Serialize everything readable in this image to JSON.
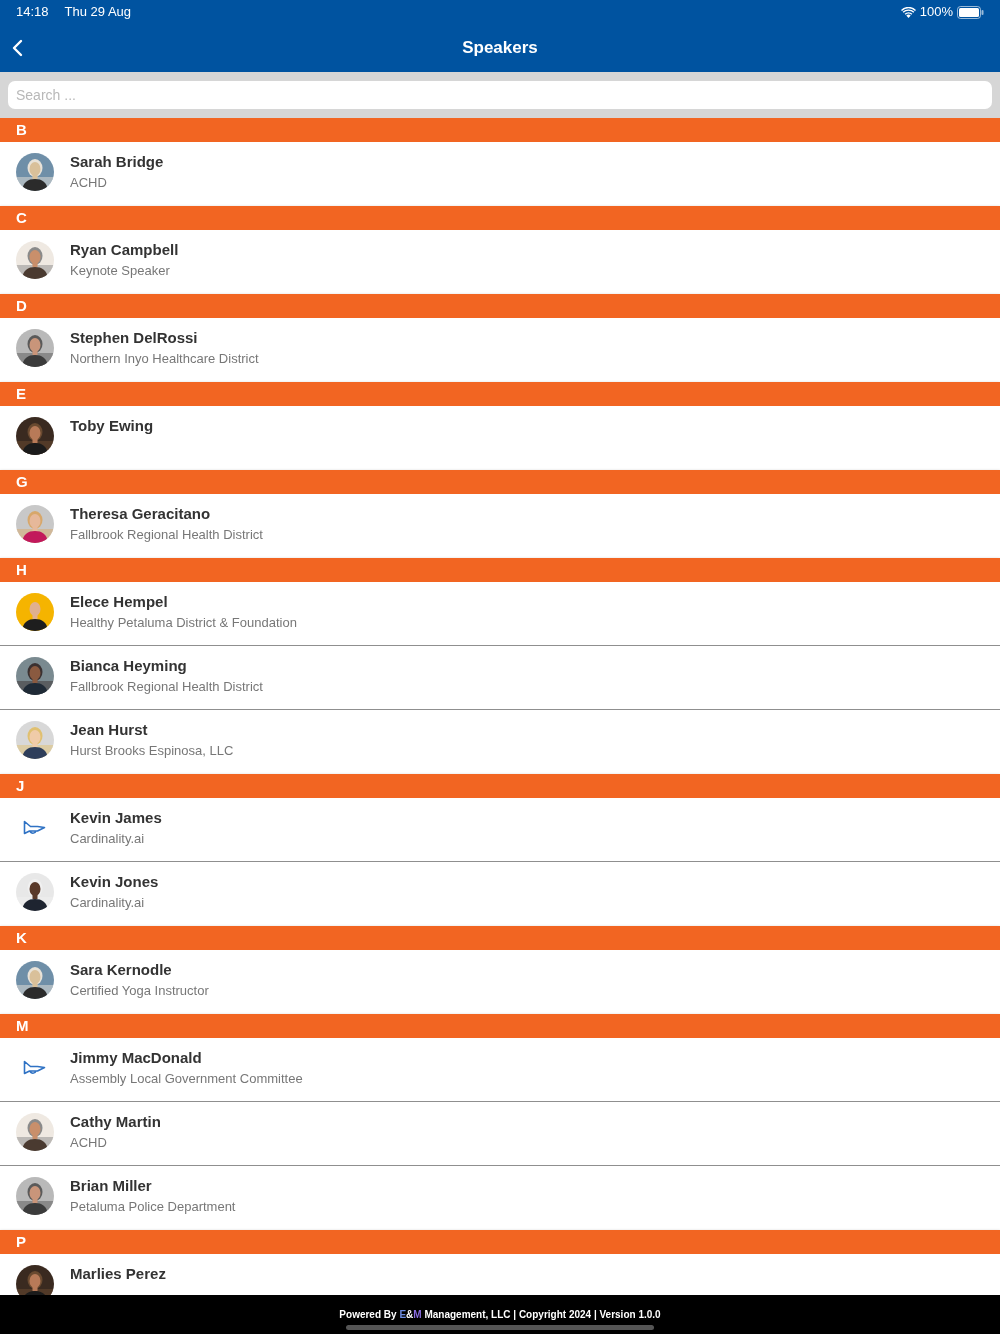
{
  "status_bar": {
    "time": "14:18",
    "date": "Thu 29 Aug",
    "battery": "100%"
  },
  "nav": {
    "title": "Speakers"
  },
  "search": {
    "placeholder": "Search ..."
  },
  "sections": [
    {
      "letter": "B",
      "speakers": [
        {
          "name": "Sarah Bridge",
          "org": "ACHD"
        }
      ]
    },
    {
      "letter": "C",
      "speakers": [
        {
          "name": "Ryan Campbell",
          "org": "Keynote Speaker"
        }
      ]
    },
    {
      "letter": "D",
      "speakers": [
        {
          "name": "Stephen DelRossi",
          "org": "Northern Inyo Healthcare District"
        }
      ]
    },
    {
      "letter": "E",
      "speakers": [
        {
          "name": "Toby Ewing"
        }
      ]
    },
    {
      "letter": "G",
      "speakers": [
        {
          "name": "Theresa Geracitano",
          "org": "Fallbrook Regional Health District"
        }
      ]
    },
    {
      "letter": "H",
      "speakers": [
        {
          "name": "Elece Hempel",
          "org": "Healthy Petaluma District & Foundation"
        },
        {
          "name": "Bianca Heyming",
          "org": "Fallbrook Regional Health District"
        },
        {
          "name": "Jean Hurst",
          "org": "Hurst Brooks Espinosa, LLC"
        }
      ]
    },
    {
      "letter": "J",
      "speakers": [
        {
          "name": "Kevin James",
          "org": "Cardinality.ai",
          "kind": "placeholder"
        },
        {
          "name": "Kevin Jones",
          "org": "Cardinality.ai"
        }
      ]
    },
    {
      "letter": "K",
      "speakers": [
        {
          "name": "Sara Kernodle",
          "org": "Certified Yoga Instructor"
        }
      ]
    },
    {
      "letter": "M",
      "speakers": [
        {
          "name": "Jimmy MacDonald",
          "org": "Assembly Local Government Committee",
          "kind": "placeholder"
        },
        {
          "name": "Cathy Martin",
          "org": "ACHD"
        },
        {
          "name": "Brian Miller",
          "org": "Petaluma Police Department"
        }
      ]
    },
    {
      "letter": "P",
      "speakers": [
        {
          "name": "Marlies Perez"
        }
      ]
    }
  ],
  "footer": {
    "prefix": "Powered By",
    "brand": "E&M",
    "suffix": "Management, LLC | Copyright 2024 | Version 1.0.0"
  }
}
